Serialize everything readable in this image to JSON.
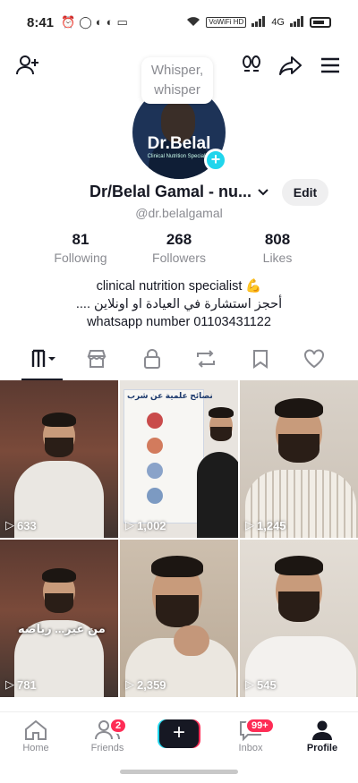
{
  "status_bar": {
    "time": "8:41",
    "network": "4G",
    "wifi_badge": "VoWiFi HD"
  },
  "profile": {
    "whisper_text": "Whisper, whisper",
    "avatar_brand": "Dr.Belal",
    "avatar_sub": "Clinical Nutrition Specialist",
    "display_name": "Dr/Belal Gamal - nu...",
    "edit_label": "Edit",
    "handle": "@dr.belalgamal"
  },
  "stats": [
    {
      "num": "81",
      "label": "Following"
    },
    {
      "num": "268",
      "label": "Followers"
    },
    {
      "num": "808",
      "label": "Likes"
    }
  ],
  "bio": {
    "line1": "clinical nutrition specialist 💪",
    "line2": "أحجز استشارة في العيادة او اونلاين ....",
    "line3": "whatsapp number 01103431122"
  },
  "tabs": [
    "videos-icon",
    "shop-icon",
    "lock-icon",
    "repost-icon",
    "bookmark-icon",
    "heart-icon"
  ],
  "videos": [
    {
      "views": "633"
    },
    {
      "views": "1,002",
      "overlay": "نصائح علمية عن شرب"
    },
    {
      "views": "1,245"
    },
    {
      "views": "781",
      "overlay": "من غير... رياضه"
    },
    {
      "views": "2,359"
    },
    {
      "views": "545"
    }
  ],
  "nav": {
    "home": "Home",
    "friends": "Friends",
    "friends_badge": "2",
    "inbox": "Inbox",
    "inbox_badge": "99+",
    "profile": "Profile"
  },
  "colors": {
    "accent_cyan": "#20d5ec",
    "accent_red": "#fe2c55",
    "text": "#161823",
    "muted": "#8a8b91"
  }
}
